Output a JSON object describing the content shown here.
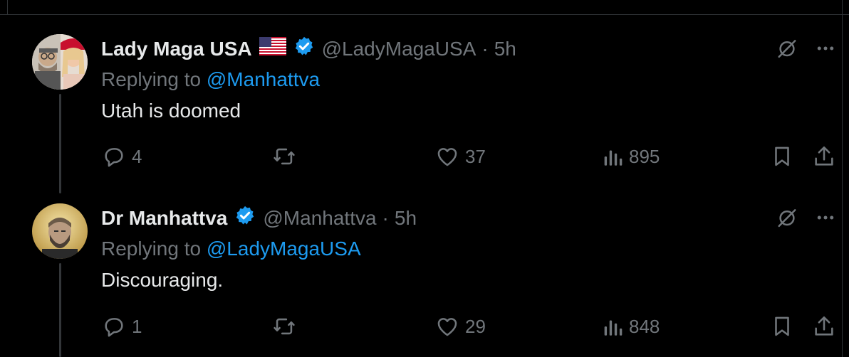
{
  "tweets": [
    {
      "display_name": "Lady Maga USA",
      "flag": "us-flag",
      "verified": true,
      "handle": "@LadyMagaUSA",
      "separator": "·",
      "time": "5h",
      "replying_prefix": "Replying to ",
      "replying_to": "@Manhattva",
      "text": "Utah is doomed",
      "replies": "4",
      "likes": "37",
      "views": "895"
    },
    {
      "display_name": "Dr Manhattva",
      "verified": true,
      "handle": "@Manhattva",
      "separator": "·",
      "time": "5h",
      "replying_prefix": "Replying to ",
      "replying_to": "@LadyMagaUSA",
      "text": "Discouraging.",
      "replies": "1",
      "likes": "29",
      "views": "848"
    }
  ],
  "colors": {
    "background": "#000000",
    "text_primary": "#e7e9ea",
    "text_secondary": "#71767b",
    "accent": "#1d9bf0",
    "divider": "#2f3336"
  },
  "icons": {
    "reply": "reply-icon",
    "retweet": "retweet-icon",
    "like": "heart-icon",
    "views": "views-icon",
    "bookmark": "bookmark-icon",
    "share": "share-icon",
    "grok": "grok-icon",
    "more": "more-icon",
    "verified": "verified-badge-icon"
  }
}
